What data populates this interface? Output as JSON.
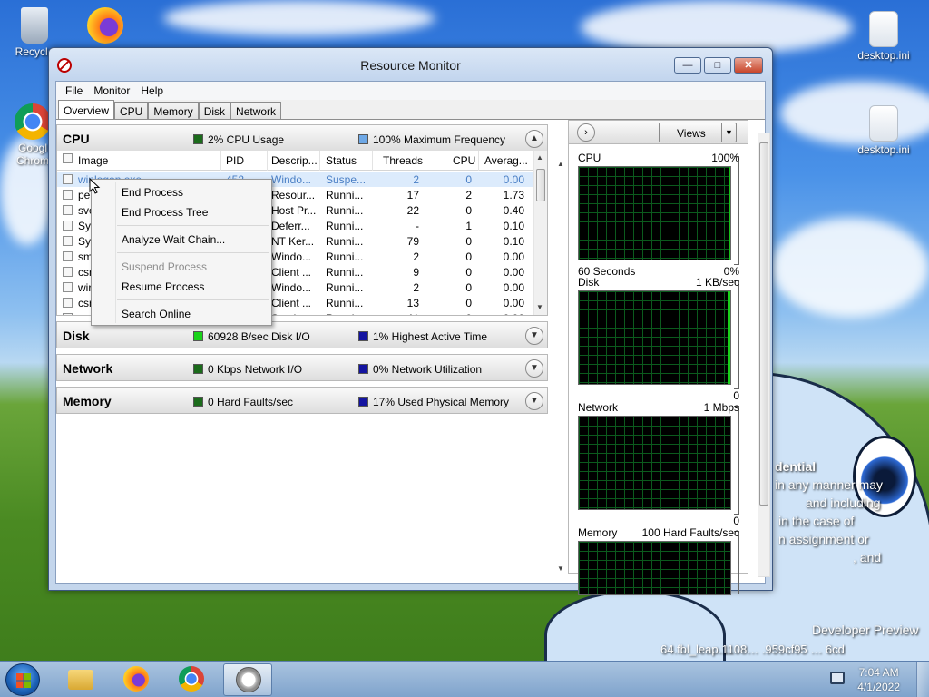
{
  "desktop": {
    "icons": [
      {
        "label": "Recycle"
      },
      {
        "label": "Googl Chrom"
      },
      {
        "label": "desktop.ini"
      },
      {
        "label": "desktop.ini"
      }
    ],
    "watermark": {
      "line1": "dential",
      "line2": "in any manner may",
      "line3": "and including",
      "line4": "in the case of",
      "line5": "n assignment or",
      "line6": ", and",
      "build_label": "Developer Preview",
      "build_string": "64.fbl_leap.1108… .959cf95 … 6cd"
    }
  },
  "window": {
    "title": "Resource Monitor",
    "buttons": {
      "minimize": "—",
      "maximize": "□",
      "close": "✕"
    },
    "menu": [
      "File",
      "Monitor",
      "Help"
    ],
    "tabs": [
      "Overview",
      "CPU",
      "Memory",
      "Disk",
      "Network"
    ],
    "active_tab": "Overview"
  },
  "cpu_section": {
    "title": "CPU",
    "stat1": {
      "text": "2% CPU Usage",
      "color": "#1b6b1b"
    },
    "stat2": {
      "text": "100% Maximum Frequency",
      "color": "#6ea8e6"
    },
    "columns": [
      "Image",
      "PID",
      "Descrip...",
      "Status",
      "Threads",
      "CPU",
      "Averag..."
    ],
    "rows": [
      {
        "image": "winlogon.exe",
        "pid": "452",
        "desc": "Windo...",
        "status": "Suspe...",
        "threads": "2",
        "cpu": "0",
        "avg": "0.00"
      },
      {
        "image": "pe",
        "pid": "",
        "desc": "Resour...",
        "status": "Runni...",
        "threads": "17",
        "cpu": "2",
        "avg": "1.73"
      },
      {
        "image": "svc",
        "pid": "",
        "desc": "Host Pr...",
        "status": "Runni...",
        "threads": "22",
        "cpu": "0",
        "avg": "0.40"
      },
      {
        "image": "Sys",
        "pid": "",
        "desc": "Deferr...",
        "status": "Runni...",
        "threads": "-",
        "cpu": "1",
        "avg": "0.10"
      },
      {
        "image": "Sys",
        "pid": "",
        "desc": "NT Ker...",
        "status": "Runni...",
        "threads": "79",
        "cpu": "0",
        "avg": "0.10"
      },
      {
        "image": "sm",
        "pid": "",
        "desc": "Windo...",
        "status": "Runni...",
        "threads": "2",
        "cpu": "0",
        "avg": "0.00"
      },
      {
        "image": "csr",
        "pid": "",
        "desc": "Client ...",
        "status": "Runni...",
        "threads": "9",
        "cpu": "0",
        "avg": "0.00"
      },
      {
        "image": "wir",
        "pid": "",
        "desc": "Windo...",
        "status": "Runni...",
        "threads": "2",
        "cpu": "0",
        "avg": "0.00"
      },
      {
        "image": "csr",
        "pid": "",
        "desc": "Client ...",
        "status": "Runni...",
        "threads": "13",
        "cpu": "0",
        "avg": "0.00"
      },
      {
        "image": "",
        "pid": "",
        "desc": "Service",
        "status": "Runni...",
        "threads": "11",
        "cpu": "0",
        "avg": "0.00"
      }
    ]
  },
  "context_menu": {
    "items": [
      "End Process",
      "End Process Tree",
      "Analyze Wait Chain...",
      "Suspend Process",
      "Resume Process",
      "Search Online"
    ]
  },
  "disk_section": {
    "title": "Disk",
    "stat1": {
      "text": "60928 B/sec Disk I/O",
      "color": "#19d219"
    },
    "stat2": {
      "text": "1% Highest Active Time",
      "color": "#1414a0"
    }
  },
  "network_section": {
    "title": "Network",
    "stat1": {
      "text": "0 Kbps Network I/O",
      "color": "#1b6b1b"
    },
    "stat2": {
      "text": "0% Network Utilization",
      "color": "#1414a0"
    }
  },
  "memory_section": {
    "title": "Memory",
    "stat1": {
      "text": "0 Hard Faults/sec",
      "color": "#1b6b1b"
    },
    "stat2": {
      "text": "17% Used Physical Memory",
      "color": "#1414a0"
    }
  },
  "right_pane": {
    "views_label": "Views",
    "graphs": [
      {
        "label": "CPU",
        "max": "100%",
        "bottom_left": "60 Seconds",
        "bottom_right": "0%"
      },
      {
        "label": "Disk",
        "max": "1 KB/sec",
        "bottom_left": "",
        "bottom_right": "0"
      },
      {
        "label": "Network",
        "max": "1 Mbps",
        "bottom_left": "",
        "bottom_right": "0"
      },
      {
        "label": "Memory",
        "max": "100 Hard Faults/sec",
        "bottom_left": "",
        "bottom_right": ""
      }
    ]
  },
  "taskbar": {
    "time": "7:04 AM",
    "date": "4/1/2022"
  }
}
